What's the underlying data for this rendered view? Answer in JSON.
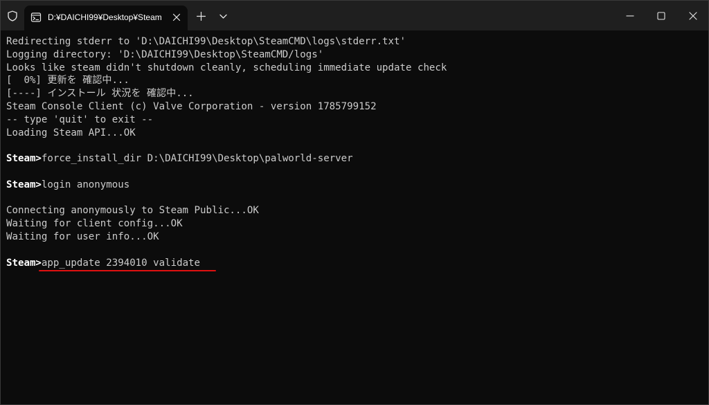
{
  "window": {
    "tab_title": "D:¥DAICHI99¥Desktop¥Steam"
  },
  "terminal": {
    "lines": [
      {
        "prompt": "",
        "text": "Redirecting stderr to 'D:\\DAICHI99\\Desktop\\SteamCMD\\logs\\stderr.txt'"
      },
      {
        "prompt": "",
        "text": "Logging directory: 'D:\\DAICHI99\\Desktop\\SteamCMD/logs'"
      },
      {
        "prompt": "",
        "text": "Looks like steam didn't shutdown cleanly, scheduling immediate update check"
      },
      {
        "prompt": "",
        "text": "[  0%] 更新を 確認中..."
      },
      {
        "prompt": "",
        "text": "[----] インストール 状況を 確認中..."
      },
      {
        "prompt": "",
        "text": "Steam Console Client (c) Valve Corporation - version 1785799152"
      },
      {
        "prompt": "",
        "text": "-- type 'quit' to exit --"
      },
      {
        "prompt": "",
        "text": "Loading Steam API...OK"
      },
      {
        "prompt": "",
        "text": ""
      },
      {
        "prompt": "Steam>",
        "text": "force_install_dir D:\\DAICHI99\\Desktop\\palworld-server"
      },
      {
        "prompt": "",
        "text": ""
      },
      {
        "prompt": "Steam>",
        "text": "login anonymous"
      },
      {
        "prompt": "",
        "text": ""
      },
      {
        "prompt": "",
        "text": "Connecting anonymously to Steam Public...OK"
      },
      {
        "prompt": "",
        "text": "Waiting for client config...OK"
      },
      {
        "prompt": "",
        "text": "Waiting for user info...OK"
      },
      {
        "prompt": "",
        "text": ""
      },
      {
        "prompt": "Steam>",
        "text": "app_update 2394010 validate"
      }
    ],
    "highlight_color": "#e01010"
  },
  "icons": {
    "shield": "shield-icon",
    "tab": "terminal-icon",
    "tab_close": "close-icon",
    "new_tab": "plus-icon",
    "dropdown": "chevron-down-icon",
    "minimize": "minimize-icon",
    "maximize": "maximize-icon",
    "close": "close-icon"
  }
}
